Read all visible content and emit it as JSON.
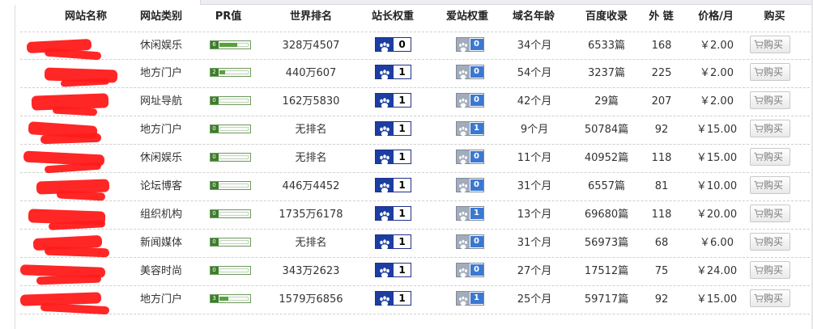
{
  "headers": {
    "name": "网站名称",
    "type": "网站类别",
    "pr": "PR值",
    "rank": "世界排名",
    "bd": "站长权重",
    "az": "爱站权重",
    "age": "域名年龄",
    "baidu": "百度收录",
    "links": "外 链",
    "price": "价格/月",
    "buy": "购买"
  },
  "colors": {
    "redaction": "#ff1a1a",
    "pr_green": "#3d7d2c",
    "baidu_blue": "#1c3ea0",
    "aizhan_blue": "#3a78d2"
  },
  "icons": {
    "pr": "pr-bar-icon",
    "baidu": "baidu-paw-icon",
    "aizhan": "aizhan-paw-icon",
    "cart": "cart-icon"
  },
  "buy_label": "购买",
  "rows": [
    {
      "type": "休闲娱乐",
      "pr": "6",
      "pr_level": 0.6,
      "rank": "328万4507",
      "bd": "0",
      "az": "0",
      "age": "34个月",
      "baidu": "6533篇",
      "links": "168",
      "price": "￥2.00"
    },
    {
      "type": "地方门户",
      "pr": "2",
      "pr_level": 0.2,
      "rank": "440万607",
      "bd": "1",
      "az": "0",
      "age": "54个月",
      "baidu": "3237篇",
      "links": "225",
      "price": "￥2.00"
    },
    {
      "type": "网址导航",
      "pr": "0",
      "pr_level": 0,
      "rank": "162万5830",
      "bd": "1",
      "az": "0",
      "age": "42个月",
      "baidu": "29篇",
      "links": "207",
      "price": "￥2.00"
    },
    {
      "type": "地方门户",
      "pr": "0",
      "pr_level": 0,
      "rank": "无排名",
      "bd": "1",
      "az": "1",
      "age": "9个月",
      "baidu": "50784篇",
      "links": "92",
      "price": "￥15.00"
    },
    {
      "type": "休闲娱乐",
      "pr": "0",
      "pr_level": 0,
      "rank": "无排名",
      "bd": "1",
      "az": "0",
      "age": "11个月",
      "baidu": "40952篇",
      "links": "118",
      "price": "￥15.00"
    },
    {
      "type": "论坛博客",
      "pr": "0",
      "pr_level": 0,
      "rank": "446万4452",
      "bd": "1",
      "az": "0",
      "age": "31个月",
      "baidu": "6557篇",
      "links": "81",
      "price": "￥10.00"
    },
    {
      "type": "组织机构",
      "pr": "0",
      "pr_level": 0,
      "rank": "1735万6178",
      "bd": "1",
      "az": "1",
      "age": "13个月",
      "baidu": "69680篇",
      "links": "118",
      "price": "￥20.00"
    },
    {
      "type": "新闻媒体",
      "pr": "0",
      "pr_level": 0,
      "rank": "无排名",
      "bd": "1",
      "az": "0",
      "age": "31个月",
      "baidu": "56973篇",
      "links": "68",
      "price": "￥6.00"
    },
    {
      "type": "美容时尚",
      "pr": "0",
      "pr_level": 0,
      "rank": "343万2623",
      "bd": "1",
      "az": "0",
      "age": "27个月",
      "baidu": "17512篇",
      "links": "75",
      "price": "￥24.00"
    },
    {
      "type": "地方门户",
      "pr": "3",
      "pr_level": 0.3,
      "rank": "1579万6856",
      "bd": "1",
      "az": "1",
      "age": "25个月",
      "baidu": "59717篇",
      "links": "92",
      "price": "￥15.00"
    }
  ]
}
